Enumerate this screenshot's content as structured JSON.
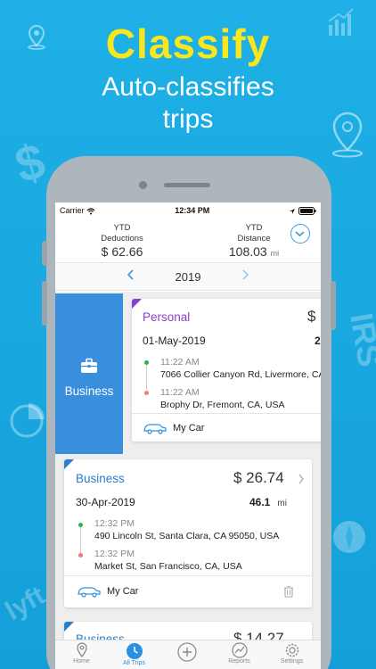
{
  "promo": {
    "headline": "Classify",
    "subline1": "Auto-classifies",
    "subline2": "trips"
  },
  "colors": {
    "headline": "#f8e71c",
    "accent": "#3a8fdc",
    "personal": "#8b3fc8",
    "business": "#2b7fc8"
  },
  "status": {
    "carrier": "Carrier",
    "time": "12:34 PM"
  },
  "summary": {
    "deductions_label_1": "YTD",
    "deductions_label_2": "Deductions",
    "deductions_value": "$ 62.66",
    "distance_label_1": "YTD",
    "distance_label_2": "Distance",
    "distance_value": "108.03",
    "distance_unit": "mi"
  },
  "year": "2019",
  "swipe_action": {
    "label": "Business",
    "icon": "briefcase-icon"
  },
  "trips": [
    {
      "category": "Personal",
      "amount": "$",
      "date": "01-May-2019",
      "distance": "2",
      "start_time": "11:22 AM",
      "start_address": "7066 Collier Canyon Rd, Livermore, CA",
      "end_time": "11:22 AM",
      "end_address": "Brophy Dr, Fremont, CA, USA",
      "vehicle": "My Car"
    },
    {
      "category": "Business",
      "amount": "$ 26.74",
      "date": "30-Apr-2019",
      "distance": "46.1",
      "unit": "mi",
      "start_time": "12:32 PM",
      "start_address": "490 Lincoln St, Santa Clara, CA 95050, USA",
      "end_time": "12:32 PM",
      "end_address": "Market St, San Francisco, CA, USA",
      "vehicle": "My Car"
    },
    {
      "category": "Business",
      "amount": "$ 14.27"
    }
  ],
  "tabs": [
    {
      "label": "Home",
      "icon": "map-pin-icon"
    },
    {
      "label": "All Trips",
      "icon": "clock-icon",
      "active": true
    },
    {
      "label": "",
      "icon": "plus-icon"
    },
    {
      "label": "Reports",
      "icon": "chart-icon"
    },
    {
      "label": "Settings",
      "icon": "gear-icon"
    }
  ]
}
